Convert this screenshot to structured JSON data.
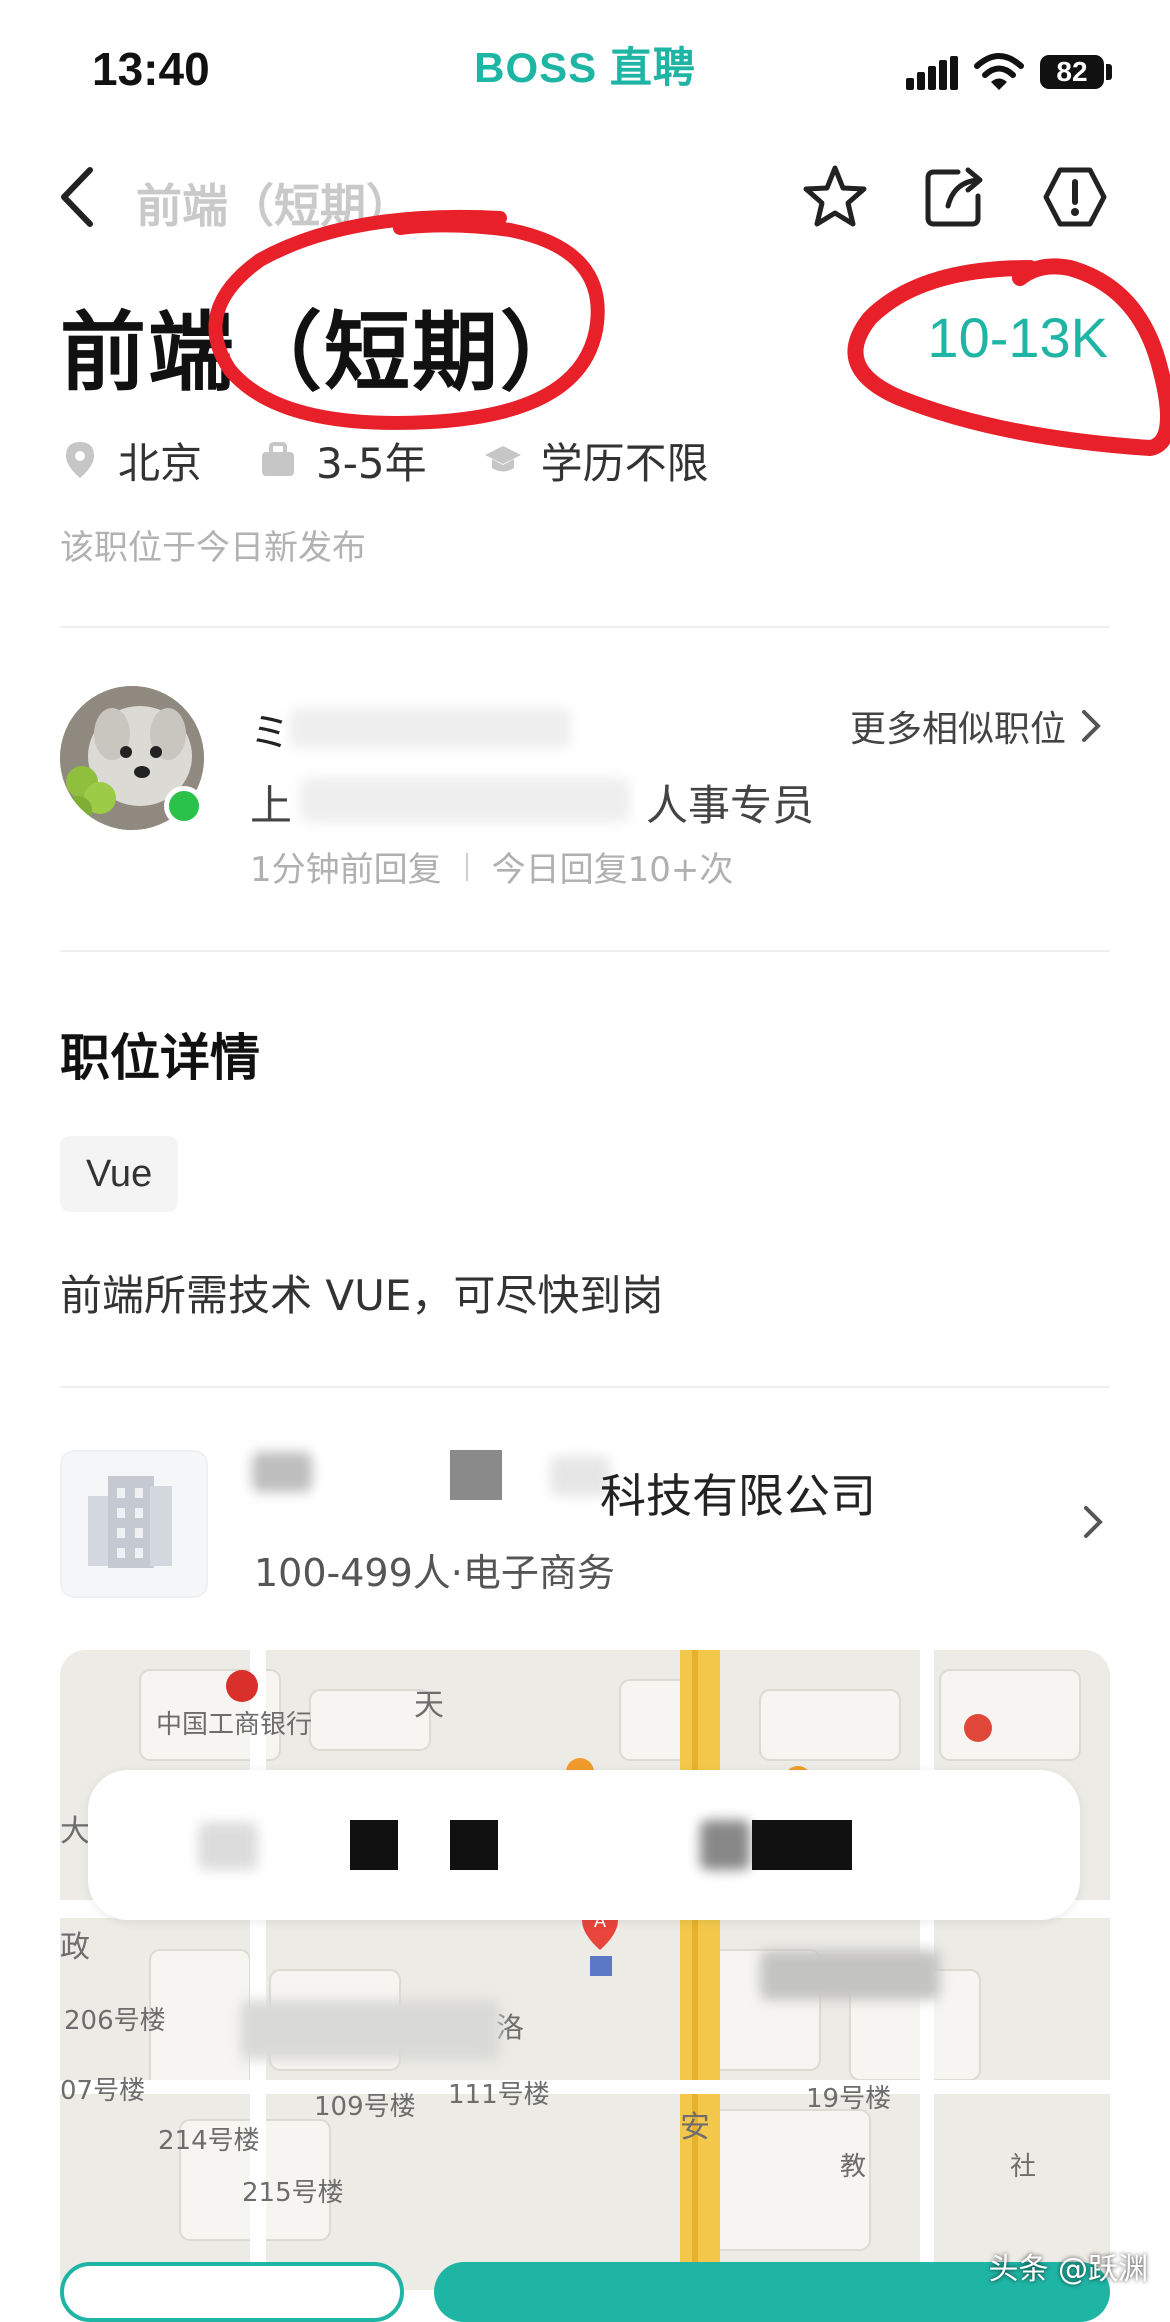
{
  "status_bar": {
    "time": "13:40",
    "brand": "BOSS 直聘",
    "battery": "82"
  },
  "nav": {
    "title": "前端（短期）",
    "icons": [
      "back-icon",
      "star-icon",
      "share-icon",
      "report-icon"
    ]
  },
  "job": {
    "title": "前端（短期）",
    "salary": "10-13K",
    "location": "北京",
    "experience": "3-5年",
    "education": "学历不限",
    "published": "该职位于今日新发布"
  },
  "recruiter": {
    "name_mark": "ミ",
    "prefix": "上",
    "role": "人事专员",
    "more_similar": "更多相似职位",
    "reply_time": "1分钟前回复",
    "reply_count": "今日回复10+次"
  },
  "details": {
    "section_title": "职位详情",
    "tag": "Vue",
    "description": "前端所需技术 VUE，可尽快到岗"
  },
  "company": {
    "name_suffix": "科技有限公司",
    "meta": "100-499人·电子商务"
  },
  "map": {
    "labels": {
      "bank": "中国工商银行",
      "tian": "天",
      "b206": "206号楼",
      "b07": "07号楼",
      "b109": "109号楼",
      "b111": "111号楼",
      "b214": "214号楼",
      "b215": "215号楼",
      "b19": "19号楼",
      "zheng": "政",
      "an": "安",
      "jiao": "教",
      "she": "社",
      "da": "大",
      "luo": "洛",
      "marker": "A"
    }
  },
  "watermark": "头条 @跃渊",
  "colors": {
    "accent": "#1fb5a5",
    "annotation": "#e8202a",
    "online": "#2bc24a"
  }
}
